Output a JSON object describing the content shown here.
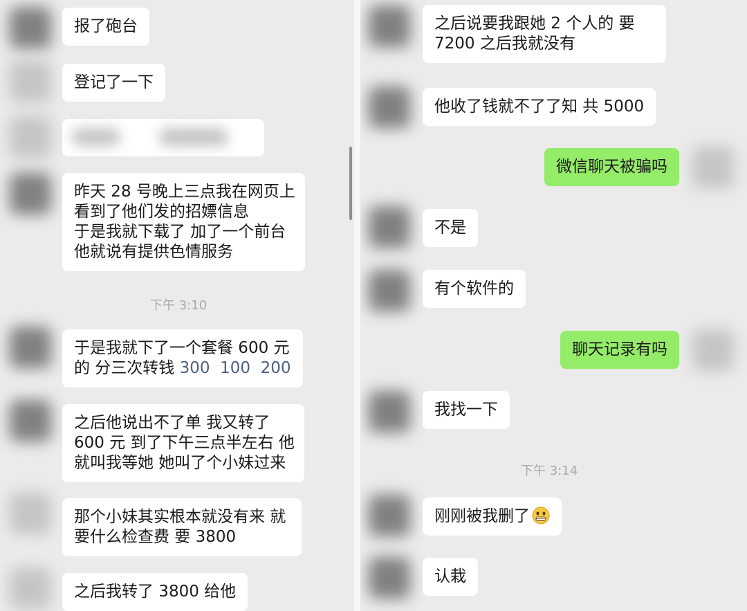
{
  "left_chat": {
    "messages": [
      {
        "lines": [
          "报了砲台"
        ]
      },
      {
        "lines": [
          "登记了一下"
        ]
      },
      {
        "lines": [
          "昨天 28 号晚上三点我在网页上",
          "看到了他们发的招嫖信息",
          "于是我就下载了 加了一个前台",
          "他就说有提供色情服务"
        ]
      },
      {
        "line1": "于是我就下了一个套餐 600 元",
        "line2_prefix": "的 分三次转钱",
        "amounts": "300  100  200"
      },
      {
        "lines": [
          "之后他说出不了单 我又转了",
          "600 元 到了下午三点半左右 他",
          "就叫我等她 她叫了个小妹过来"
        ]
      },
      {
        "lines": [
          "那个小妹其实根本就没有来 就",
          "要什么检查费 要 3800"
        ]
      },
      {
        "lines": [
          "之后我转了 3800 给他"
        ]
      }
    ],
    "timestamp": "下午 3:10"
  },
  "right_chat": {
    "messages": [
      {
        "lines": [
          "之后说要我跟她 2 个人的 要",
          "7200 之后我就没有"
        ]
      },
      {
        "lines": [
          "他收了钱就不了了知 共 5000"
        ]
      },
      {
        "lines": [
          "微信聊天被骗吗"
        ]
      },
      {
        "lines": [
          "不是"
        ]
      },
      {
        "lines": [
          "有个软件的"
        ]
      },
      {
        "lines": [
          "聊天记录有吗"
        ]
      },
      {
        "lines": [
          "我找一下"
        ]
      },
      {
        "lines": [
          "刚刚被我删了"
        ],
        "emoji": "grin-emoji"
      },
      {
        "lines": [
          "认栽"
        ]
      }
    ],
    "timestamp": "下午 3:14"
  },
  "colors": {
    "chat_background": "#ebebeb",
    "incoming_bubble": "#ffffff",
    "outgoing_bubble": "#95ec69",
    "amount_text": "#4d5f80",
    "timestamp_text": "#a9a9a9"
  }
}
